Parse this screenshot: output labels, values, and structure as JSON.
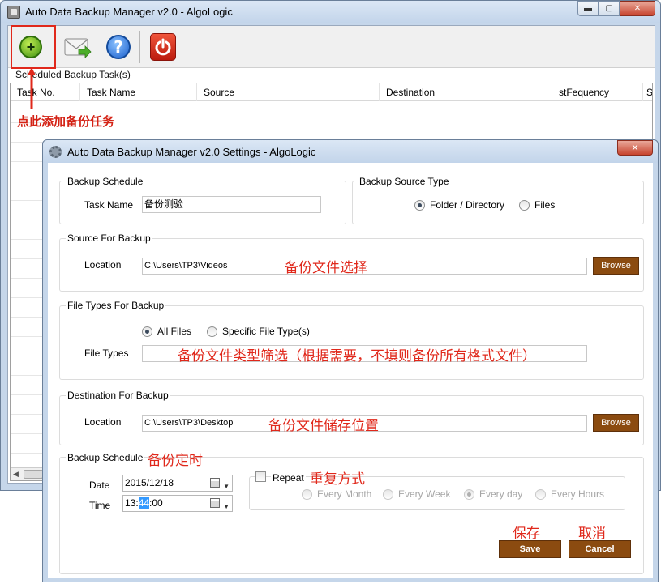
{
  "main_window": {
    "title": "Auto Data Backup Manager v2.0 - AlgoLogic",
    "window_buttons": {
      "minimize": "▬",
      "maximize": "▢",
      "close": "✕"
    },
    "toolbar": [
      {
        "name": "add-task",
        "icon": "plus-icon"
      },
      {
        "name": "email",
        "icon": "mail-arrow-icon"
      },
      {
        "name": "help",
        "icon": "help-icon",
        "glyph": "?"
      },
      {
        "name": "exit",
        "icon": "power-icon"
      }
    ],
    "grid_label": "Scheduled Backup Task(s)",
    "columns": [
      "Task No.",
      "Task Name",
      "Source",
      "Destination",
      "stFequency",
      "S"
    ],
    "annotation": "点此添加备份任务",
    "highlight_color": "#e0281b"
  },
  "settings": {
    "title": "Auto Data Backup Manager v2.0 Settings - AlgoLogic",
    "close_glyph": "✕",
    "backup_schedule_group": "Backup Schedule",
    "task_name_label": "Task Name",
    "task_name_value": "备份测验",
    "source_type_group": "Backup Source Type",
    "source_type_options": [
      "Folder / Directory",
      "Files"
    ],
    "source_type_selected": "Folder / Directory",
    "source_group": "Source For Backup",
    "source_location_label": "Location",
    "source_location_value": "C:\\Users\\TP3\\Videos",
    "source_note": "备份文件选择",
    "browse_label": "Browse",
    "file_types_group": "File Types For Backup",
    "file_type_options": [
      "All Files",
      "Specific File Type(s)"
    ],
    "file_type_selected": "All Files",
    "file_types_label": "File Types",
    "file_types_value": "",
    "file_types_note": "备份文件类型筛选（根据需要，不填则备份所有格式文件）",
    "destination_group": "Destination For Backup",
    "destination_location_label": "Location",
    "destination_location_value": "C:\\Users\\TP3\\Desktop",
    "destination_note": "备份文件储存位置",
    "schedule_group": "Backup Schedule",
    "schedule_note": "备份定时",
    "date_label": "Date",
    "date_value": "2015/12/18",
    "time_label": "Time",
    "time_prefix": "13:",
    "time_selected": "44",
    "time_suffix": ":00",
    "repeat_label": "Repeat",
    "repeat_checked": false,
    "repeat_note": "重复方式",
    "repeat_options": [
      "Every Month",
      "Every Week",
      "Every day",
      "Every Hours"
    ],
    "repeat_selected": "Every day",
    "save_note": "保存",
    "cancel_note": "取消",
    "save_label": "Save",
    "cancel_label": "Cancel",
    "button_color": "#8b4b10"
  }
}
